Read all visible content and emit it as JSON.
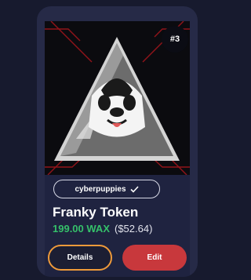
{
  "card": {
    "rank": "#3",
    "artwork_description": "franky-token-artwork",
    "collection": "cyberpuppies",
    "collection_verified_icon": "check-icon",
    "name": "Franky Token",
    "price_wax": "199.00 WAX",
    "price_usd": "($52.64)",
    "details_label": "Details",
    "edit_label": "Edit"
  },
  "colors": {
    "background": "#171a2e",
    "card": "#262a47",
    "price_green": "#35c06a",
    "details_border": "#ef9a3a",
    "edit_red": "#c8383c"
  }
}
